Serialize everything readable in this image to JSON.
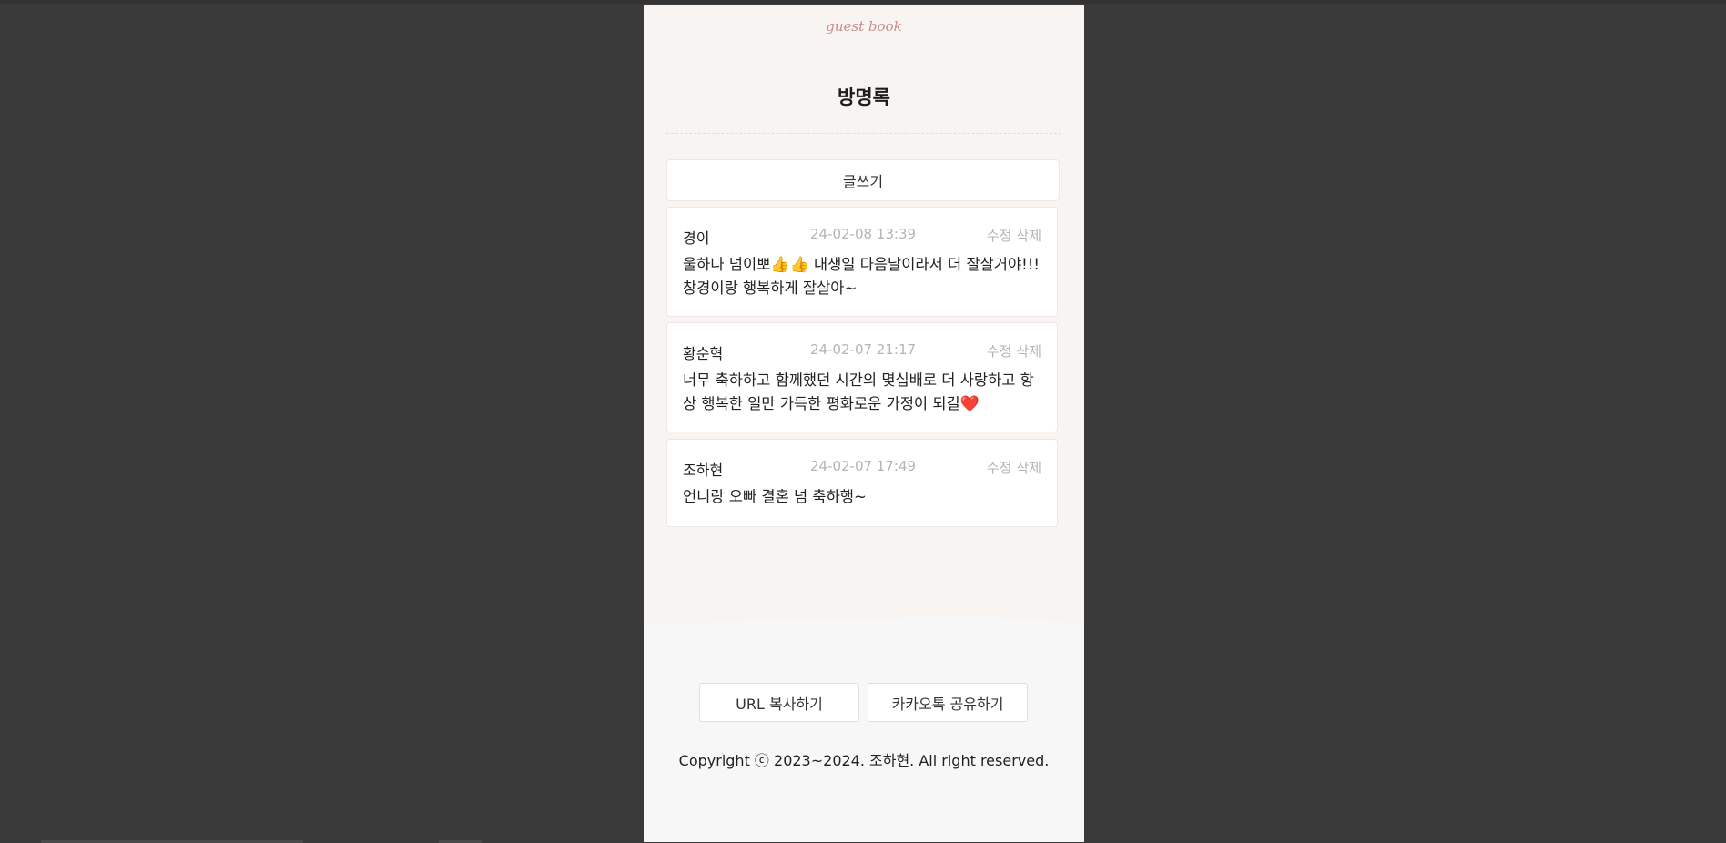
{
  "header": {
    "subtitle": "guest book",
    "title": "방명록"
  },
  "write_button_label": "글쓰기",
  "entries": [
    {
      "author": "경이",
      "datetime": "24-02-08 13:39",
      "edit_label": "수정",
      "delete_label": "삭제",
      "message_part1": "울하나 넘이뽀",
      "message_emoji": "👍👍",
      "message_part2": " 내생일 다음날이라서 더 잘살거야!!! 창경이랑 행복하게 잘살아~"
    },
    {
      "author": "황순혁",
      "datetime": "24-02-07 21:17",
      "edit_label": "수정",
      "delete_label": "삭제",
      "message_part1": "너무 축하하고 함께했던 시간의 몇십배로 더 사랑하고 항상 행복한 일만 가득한 평화로운 가정이 되길",
      "message_emoji": "❤️",
      "message_part2": ""
    },
    {
      "author": "조하현",
      "datetime": "24-02-07 17:49",
      "edit_label": "수정",
      "delete_label": "삭제",
      "message_part1": "언니랑 오빠 결혼 넘 축하행~",
      "message_emoji": "",
      "message_part2": ""
    }
  ],
  "footer": {
    "copy_url_label": "URL 복사하기",
    "kakao_share_label": "카카오톡 공유하기",
    "copyright": "Copyright ⓒ 2023~2024. 조하현. All right reserved."
  }
}
